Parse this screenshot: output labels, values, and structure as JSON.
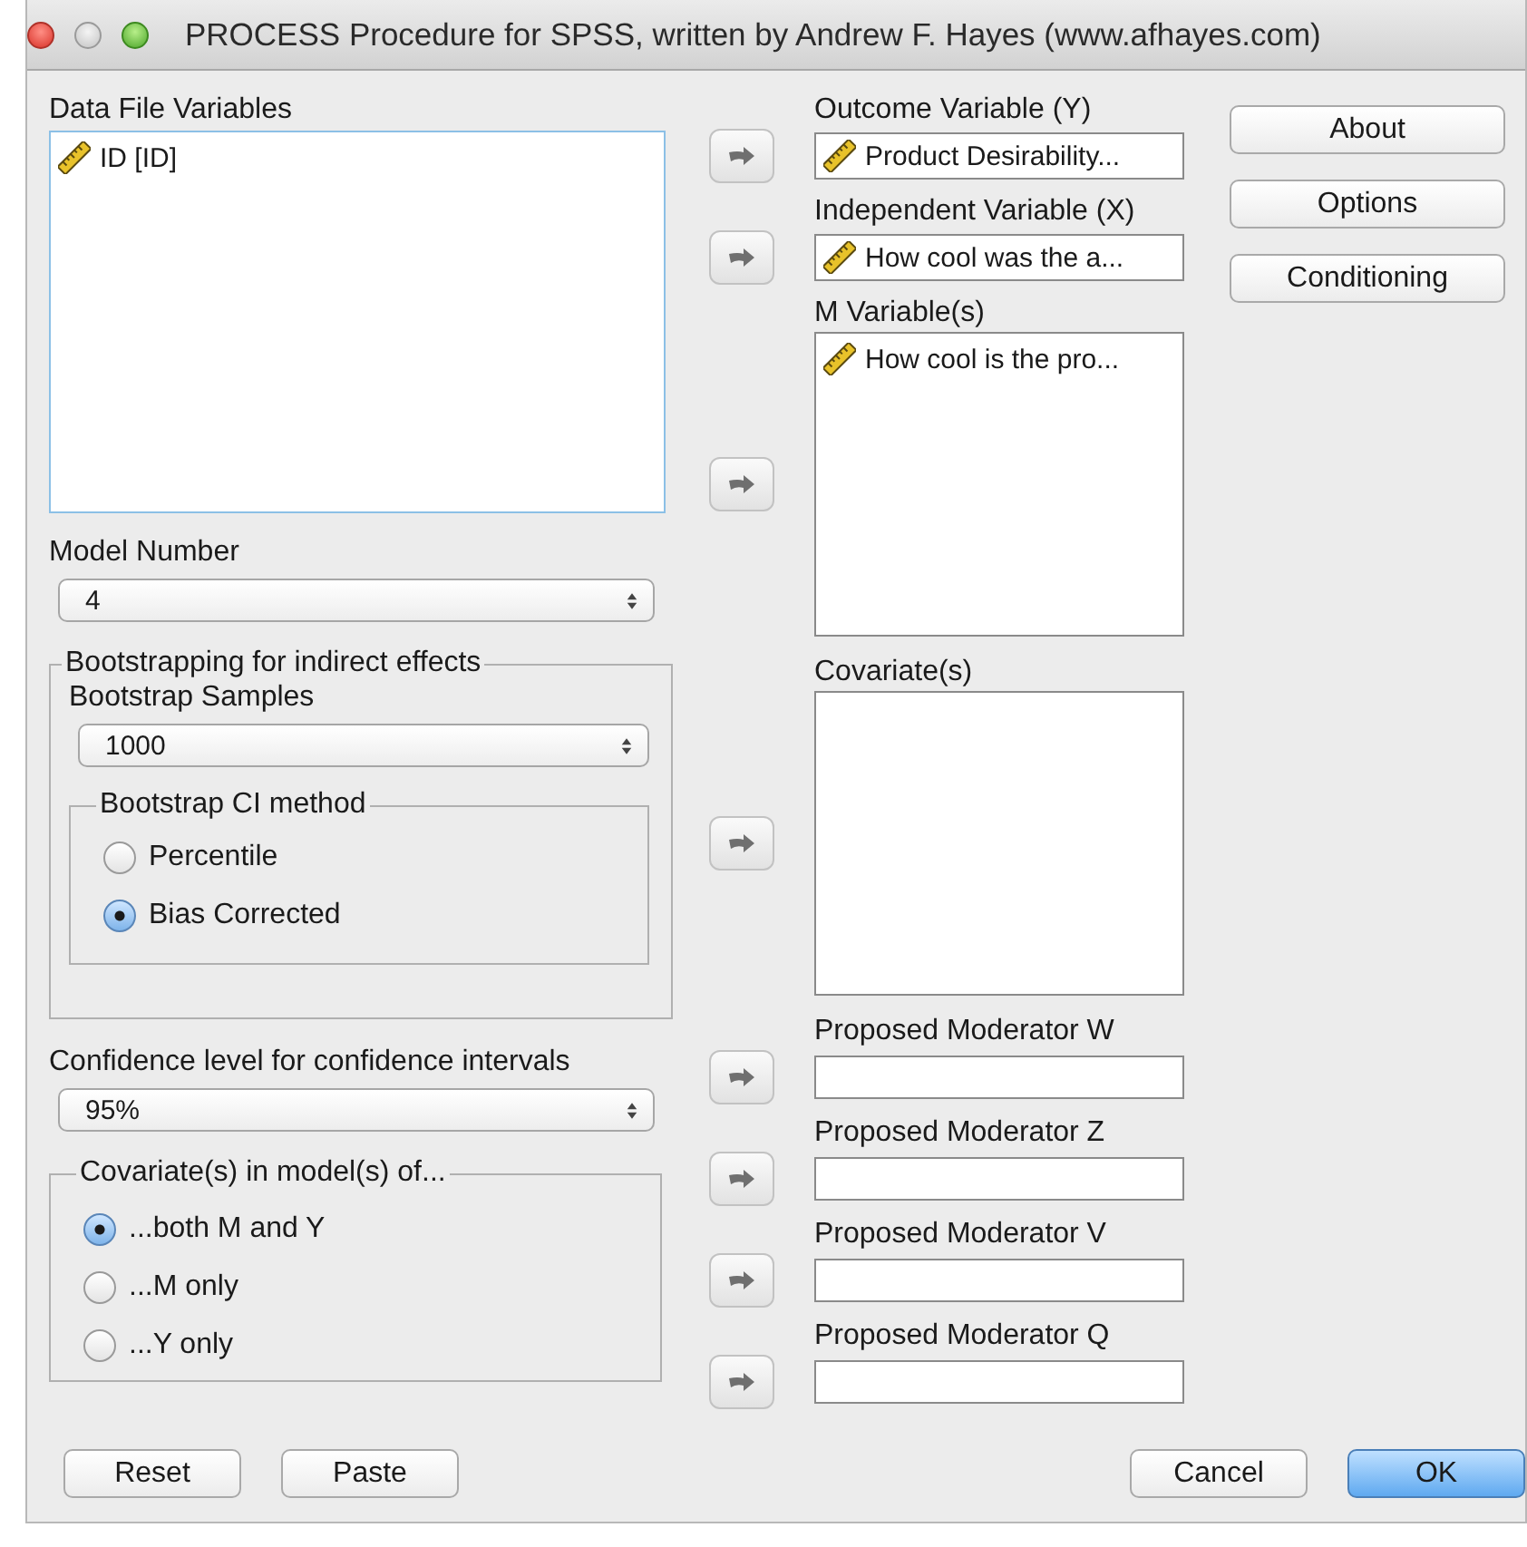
{
  "window": {
    "title": "PROCESS Procedure for SPSS, written by Andrew F. Hayes (www.afhayes.com)"
  },
  "data_file_variables": {
    "label": "Data File Variables",
    "items": [
      "ID [ID]"
    ]
  },
  "model_number": {
    "label": "Model Number",
    "value": "4"
  },
  "bootstrapping": {
    "title": "Bootstrapping for indirect effects",
    "samples_label": "Bootstrap Samples",
    "samples_value": "1000",
    "ci_method": {
      "title": "Bootstrap CI method",
      "options": [
        {
          "label": "Percentile",
          "selected": false
        },
        {
          "label": "Bias Corrected",
          "selected": true
        }
      ]
    }
  },
  "confidence": {
    "label": "Confidence level for confidence intervals",
    "value": "95%"
  },
  "covariates_in": {
    "title": "Covariate(s) in model(s) of...",
    "options": [
      {
        "label": "...both M and Y",
        "selected": true
      },
      {
        "label": "...M only",
        "selected": false
      },
      {
        "label": "...Y only",
        "selected": false
      }
    ]
  },
  "targets": [
    {
      "label": "Outcome Variable (Y)",
      "kind": "single",
      "items": [
        "Product Desirability..."
      ]
    },
    {
      "label": "Independent Variable (X)",
      "kind": "single",
      "items": [
        "How cool was the a..."
      ]
    },
    {
      "label": "M Variable(s)",
      "kind": "list",
      "items": [
        "How cool is the pro..."
      ]
    },
    {
      "label": "Covariate(s)",
      "kind": "list"
    },
    {
      "label": "Proposed Moderator W",
      "kind": "single"
    },
    {
      "label": "Proposed Moderator Z",
      "kind": "single"
    },
    {
      "label": "Proposed Moderator V",
      "kind": "single"
    },
    {
      "label": "Proposed Moderator Q",
      "kind": "single"
    }
  ],
  "side_buttons": [
    "About",
    "Options",
    "Conditioning"
  ],
  "bottom_left_buttons": [
    {
      "label": "Reset",
      "default": false
    },
    {
      "label": "Paste",
      "default": false
    }
  ],
  "bottom_right_buttons": [
    {
      "label": "Cancel",
      "default": false
    },
    {
      "label": "OK",
      "default": true
    }
  ]
}
